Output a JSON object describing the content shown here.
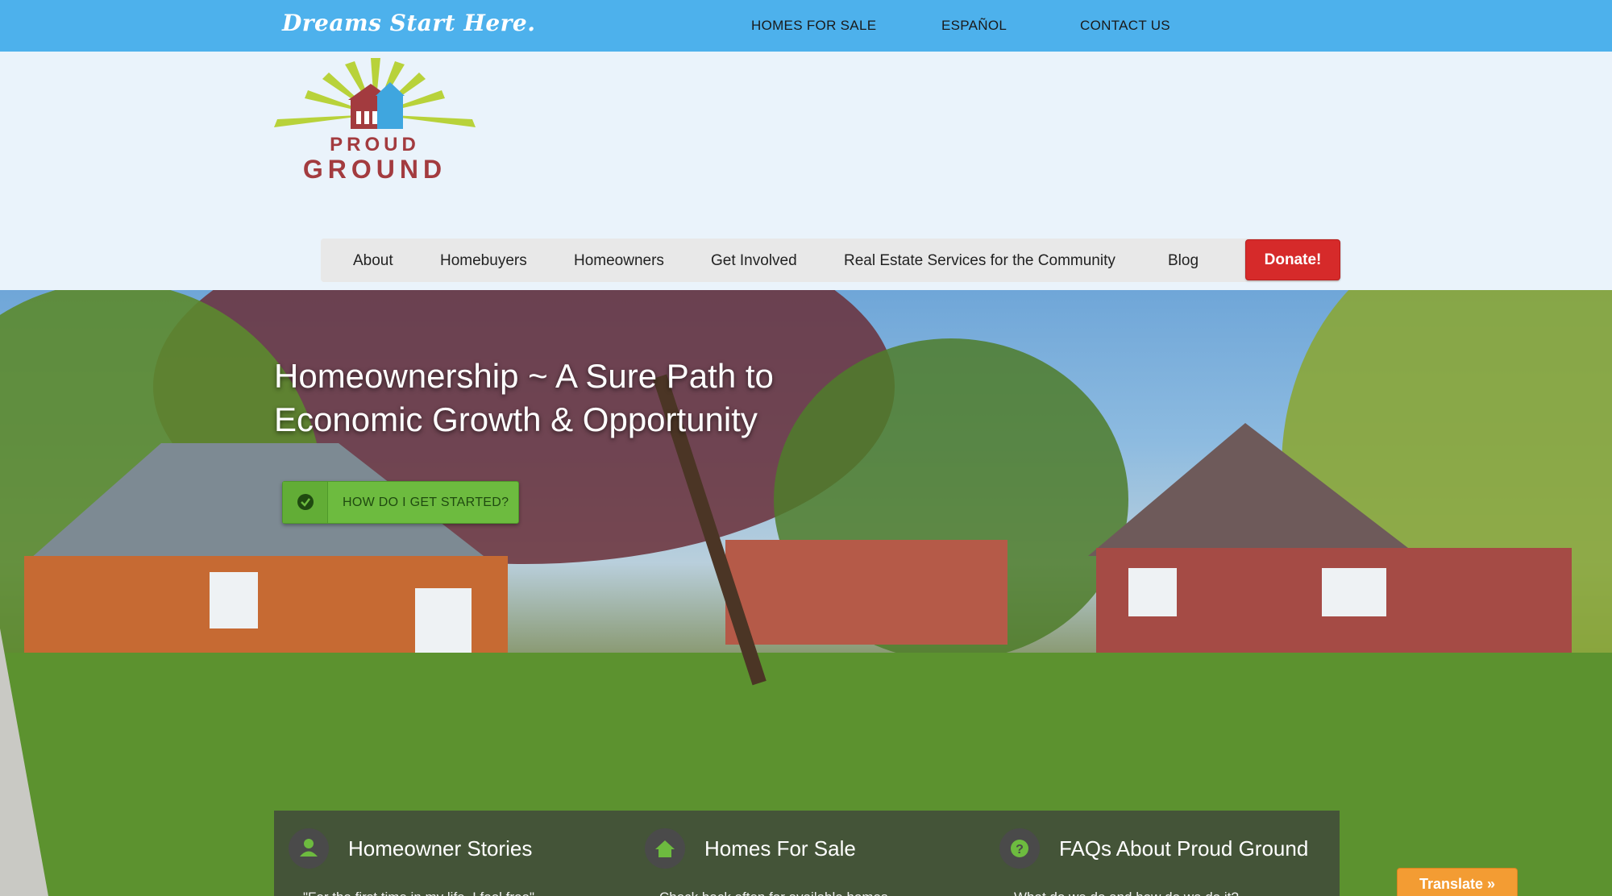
{
  "topbar": {
    "tagline": "Dreams Start Here.",
    "links": [
      "HOMES FOR SALE",
      "ESPAÑOL",
      "CONTACT US"
    ]
  },
  "logo": {
    "line1": "PROUD",
    "line2": "GROUND"
  },
  "nav": {
    "items": [
      "About",
      "Homebuyers",
      "Homeowners",
      "Get Involved",
      "Real Estate Services for the Community",
      "Blog"
    ],
    "donate": "Donate!"
  },
  "hero": {
    "title_line1": "Homeownership ~ A Sure Path to",
    "title_line2": "Economic Growth & Opportunity",
    "cta": "HOW DO I GET STARTED?"
  },
  "features": [
    {
      "title": "Homeowner Stories",
      "subtitle": "\"For the first time in my life, I feel free\"",
      "icon": "user-icon"
    },
    {
      "title": "Homes For Sale",
      "subtitle": "Check back often for available homes",
      "icon": "home-icon"
    },
    {
      "title": "FAQs About Proud Ground",
      "subtitle": "What do we do and how do we do it?",
      "icon": "question-icon"
    }
  ],
  "translate": "Translate »",
  "colors": {
    "topbar": "#4db1ec",
    "donate": "#d62a2a",
    "cta": "#6dbb3f",
    "translate": "#f39c33",
    "logo_red": "#a33b3f"
  }
}
